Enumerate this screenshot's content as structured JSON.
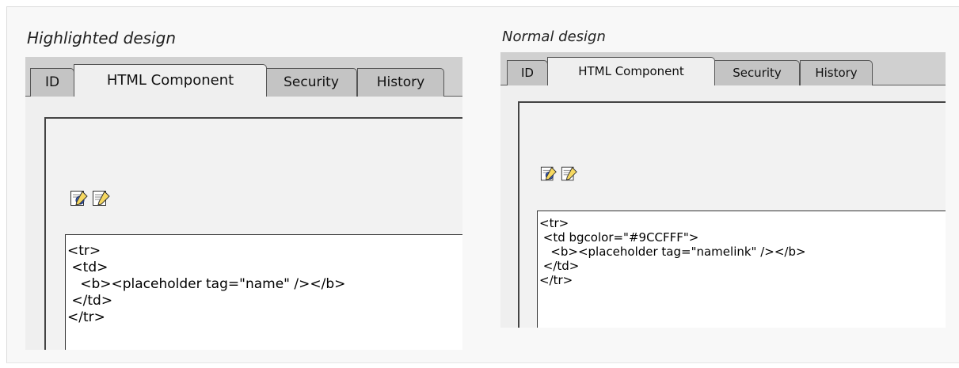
{
  "highlighted": {
    "caption": "Highlighted design",
    "tabs": [
      {
        "label": "ID",
        "active": false
      },
      {
        "label": "HTML Component",
        "active": true
      },
      {
        "label": "Security",
        "active": false
      },
      {
        "label": "History",
        "active": false
      }
    ],
    "toolbar_icons": [
      "edit-icon",
      "edit-doc-icon"
    ],
    "code_lines": [
      "<tr>",
      " <td>",
      "   <b><placeholder tag=\"name\" /></b>",
      " </td>",
      "</tr>"
    ]
  },
  "normal": {
    "caption": "Normal design",
    "tabs": [
      {
        "label": "ID",
        "active": false
      },
      {
        "label": "HTML Component",
        "active": true
      },
      {
        "label": "Security",
        "active": false
      },
      {
        "label": "History",
        "active": false
      }
    ],
    "toolbar_icons": [
      "edit-icon",
      "edit-doc-icon"
    ],
    "code_lines": [
      "<tr>",
      " <td bgcolor=\"#9CCFFF\">",
      "   <b><placeholder tag=\"namelink\" /></b>",
      " </td>",
      "</tr>"
    ]
  }
}
